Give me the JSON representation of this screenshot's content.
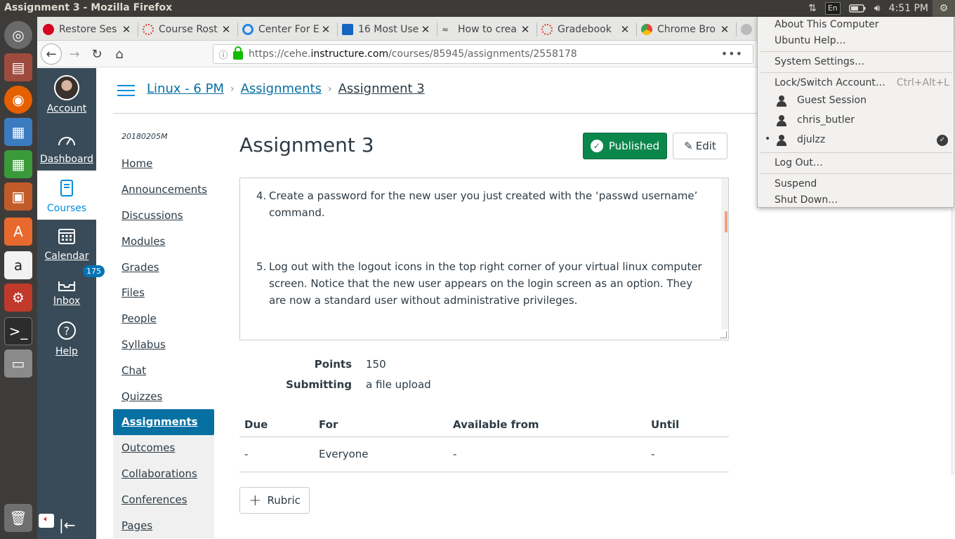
{
  "window_title": "Assignment 3 - Mozilla Firefox",
  "tray": {
    "language": "En",
    "time": "4:51 PM"
  },
  "tabs": [
    {
      "label": "Restore Ses",
      "icon": "error-icon",
      "color": "#d70022"
    },
    {
      "label": "Course Rost",
      "icon": "canvas-icon",
      "color": "#e03e2d"
    },
    {
      "label": "Center For E",
      "icon": "site-icon",
      "color": "#1e88e5"
    },
    {
      "label": "16 Most Use",
      "icon": "site-icon",
      "color": "#1565c0"
    },
    {
      "label": "How to crea",
      "icon": "site-icon",
      "color": "#333333"
    },
    {
      "label": "Gradebook",
      "icon": "canvas-icon",
      "color": "#e03e2d"
    },
    {
      "label": "Chrome Bro",
      "icon": "chrome-icon",
      "color": "#4caf50"
    }
  ],
  "urlbar": {
    "prefix": "https://cehe.",
    "domain": "instructure.com",
    "path": "/courses/85945/assignments/2558178"
  },
  "global_nav": {
    "account": "Account",
    "dashboard": "Dashboard",
    "courses": "Courses",
    "calendar": "Calendar",
    "inbox": "Inbox",
    "inbox_badge": "175",
    "help": "Help"
  },
  "breadcrumbs": {
    "course": "Linux - 6 PM",
    "section": "Assignments",
    "current": "Assignment 3"
  },
  "course_nav": {
    "code": "20180205M",
    "items": [
      "Home",
      "Announcements",
      "Discussions",
      "Modules",
      "Grades",
      "Files",
      "People",
      "Syllabus",
      "Chat",
      "Quizzes",
      "Assignments",
      "Outcomes",
      "Collaborations",
      "Conferences",
      "Pages"
    ],
    "active": "Assignments"
  },
  "assignment": {
    "title": "Assignment 3",
    "published_label": "Published",
    "edit_label": "Edit",
    "steps": [
      {
        "num": "4.",
        "text": "Create a password for the new user you just created with the ‘passwd username’ command."
      },
      {
        "num": "5.",
        "text": "Log out with the logout icons in the top right corner of your virtual linux computer screen. Notice that the new user appears on the login screen as an option. They are now a standard user without administrative privileges."
      }
    ],
    "points_label": "Points",
    "points_value": "150",
    "submitting_label": "Submitting",
    "submitting_value": "a file upload",
    "table": {
      "headers": [
        "Due",
        "For",
        "Available from",
        "Until"
      ],
      "row": [
        "-",
        "Everyone",
        "-",
        "-"
      ]
    },
    "rubric_label": "Rubric"
  },
  "session_menu": {
    "about": "About This Computer",
    "help": "Ubuntu Help…",
    "settings": "System Settings…",
    "lock": "Lock/Switch Account…",
    "lock_shortcut": "Ctrl+Alt+L",
    "users": [
      "Guest Session",
      "chris_butler",
      "djulzz"
    ],
    "logout": "Log Out…",
    "suspend": "Suspend",
    "shutdown": "Shut Down…"
  }
}
